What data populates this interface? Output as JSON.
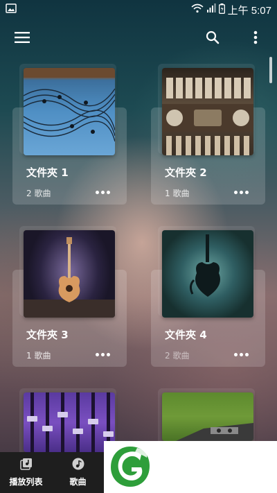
{
  "status_bar": {
    "time": "上午 5:07",
    "icons": [
      "image-icon",
      "wifi-icon",
      "signal-icon",
      "battery-icon"
    ]
  },
  "app_bar": {
    "icons": [
      "menu-icon",
      "search-icon",
      "more-vert-icon"
    ]
  },
  "folders": [
    {
      "title": "文件夾 1",
      "count": "2 歌曲",
      "cover": "music-staff-art"
    },
    {
      "title": "文件夾 2",
      "count": "1 歌曲",
      "cover": "piano-keys-art"
    },
    {
      "title": "文件夾 3",
      "count": "1 歌曲",
      "cover": "guitar-art"
    },
    {
      "title": "文件夾 4",
      "count": "2 歌曲",
      "cover": "violin-art"
    },
    {
      "cover": "mixer-art"
    },
    {
      "cover": "grass-art"
    }
  ],
  "bottom_nav": {
    "items": [
      {
        "label": "播放列表",
        "icon": "playlist-icon"
      },
      {
        "label": "歌曲",
        "icon": "music-note-icon"
      }
    ]
  },
  "logo": {
    "name": "green-leaf-logo",
    "color": "#2e9e3a"
  }
}
